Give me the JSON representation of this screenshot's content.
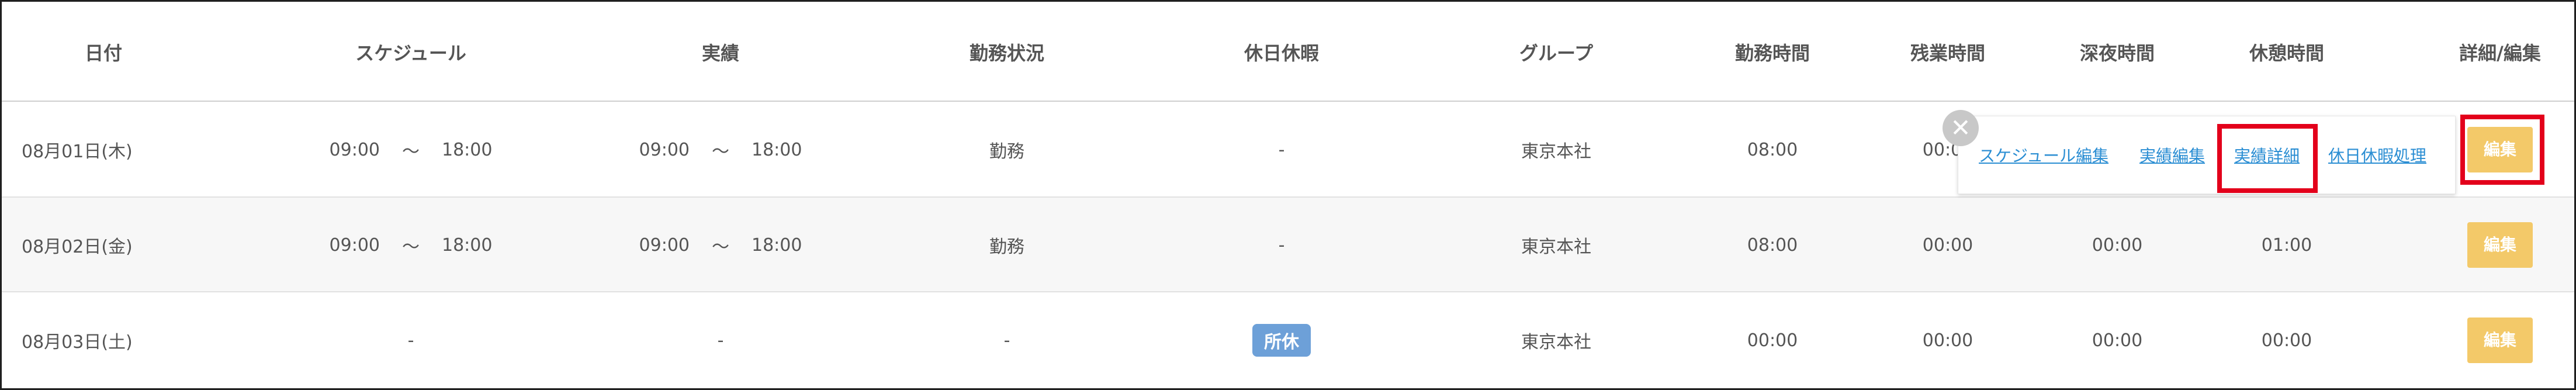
{
  "headers": {
    "date": "日付",
    "schedule": "スケジュール",
    "actual": "実績",
    "status": "勤務状況",
    "holiday": "休日休暇",
    "group": "グループ",
    "work_time": "勤務時間",
    "overtime": "残業時間",
    "night_time": "深夜時間",
    "break_time": "休憩時間",
    "edit": "詳細/編集"
  },
  "rows": [
    {
      "date": "08月01日(木)",
      "schedule_start": "09:00",
      "schedule_sep": "〜",
      "schedule_end": "18:00",
      "actual_start": "09:00",
      "actual_sep": "〜",
      "actual_end": "18:00",
      "status": "勤務",
      "holiday": "-",
      "group": "東京本社",
      "work_time": "08:00",
      "overtime": "00:00",
      "night_time": "",
      "break_time": "",
      "edit_label": "編集"
    },
    {
      "date": "08月02日(金)",
      "schedule_start": "09:00",
      "schedule_sep": "〜",
      "schedule_end": "18:00",
      "actual_start": "09:00",
      "actual_sep": "〜",
      "actual_end": "18:00",
      "status": "勤務",
      "holiday": "-",
      "group": "東京本社",
      "work_time": "08:00",
      "overtime": "00:00",
      "night_time": "00:00",
      "break_time": "01:00",
      "edit_label": "編集"
    },
    {
      "date": "08月03日(土)",
      "schedule": "-",
      "actual": "-",
      "status": "-",
      "holiday_badge": "所休",
      "group": "東京本社",
      "work_time": "00:00",
      "overtime": "00:00",
      "night_time": "00:00",
      "break_time": "00:00",
      "edit_label": "編集"
    }
  ],
  "popup": {
    "close_symbol": "✕",
    "links": [
      "スケジュール編集",
      "実績編集",
      "実績詳細",
      "休日休暇処理"
    ]
  },
  "colors": {
    "edit_button": "#f3c969",
    "highlight": "#e3001b",
    "link": "#2b8ed3",
    "badge": "#6da0d8"
  }
}
